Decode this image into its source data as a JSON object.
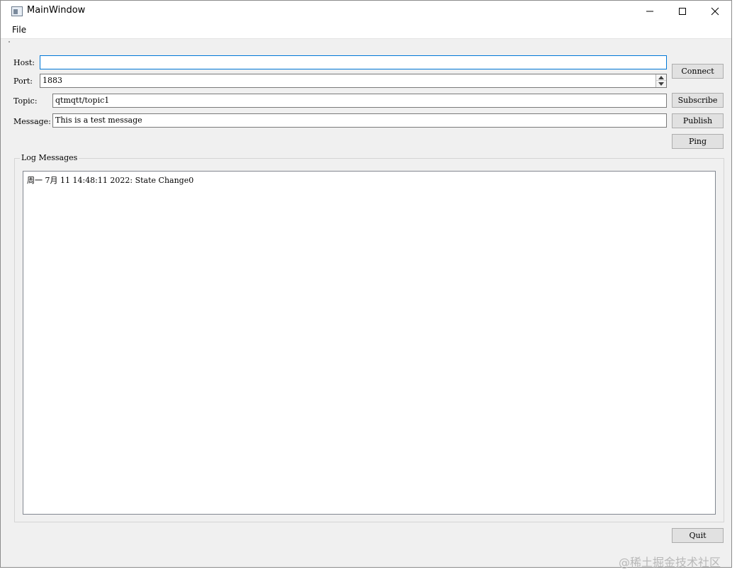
{
  "window": {
    "title": "MainWindow",
    "icon": "app-window-icon"
  },
  "menu": {
    "file": "File"
  },
  "form": {
    "host_label": "Host:",
    "host_value": "",
    "port_label": "Port:",
    "port_value": "1883",
    "topic_label": "Topic:",
    "topic_value": "qtmqtt/topic1",
    "message_label": "Message:",
    "message_value": "This is a test message"
  },
  "buttons": {
    "connect": "Connect",
    "subscribe": "Subscribe",
    "publish": "Publish",
    "ping": "Ping",
    "quit": "Quit"
  },
  "log": {
    "title": "Log Messages",
    "lines": [
      "周一 7月 11 14:48:11 2022: State Change0"
    ]
  },
  "watermark": "@稀土掘金技术社区",
  "colors": {
    "focus_border": "#0078d7",
    "window_bg": "#f0f0f0",
    "button_bg": "#e1e1e1"
  }
}
